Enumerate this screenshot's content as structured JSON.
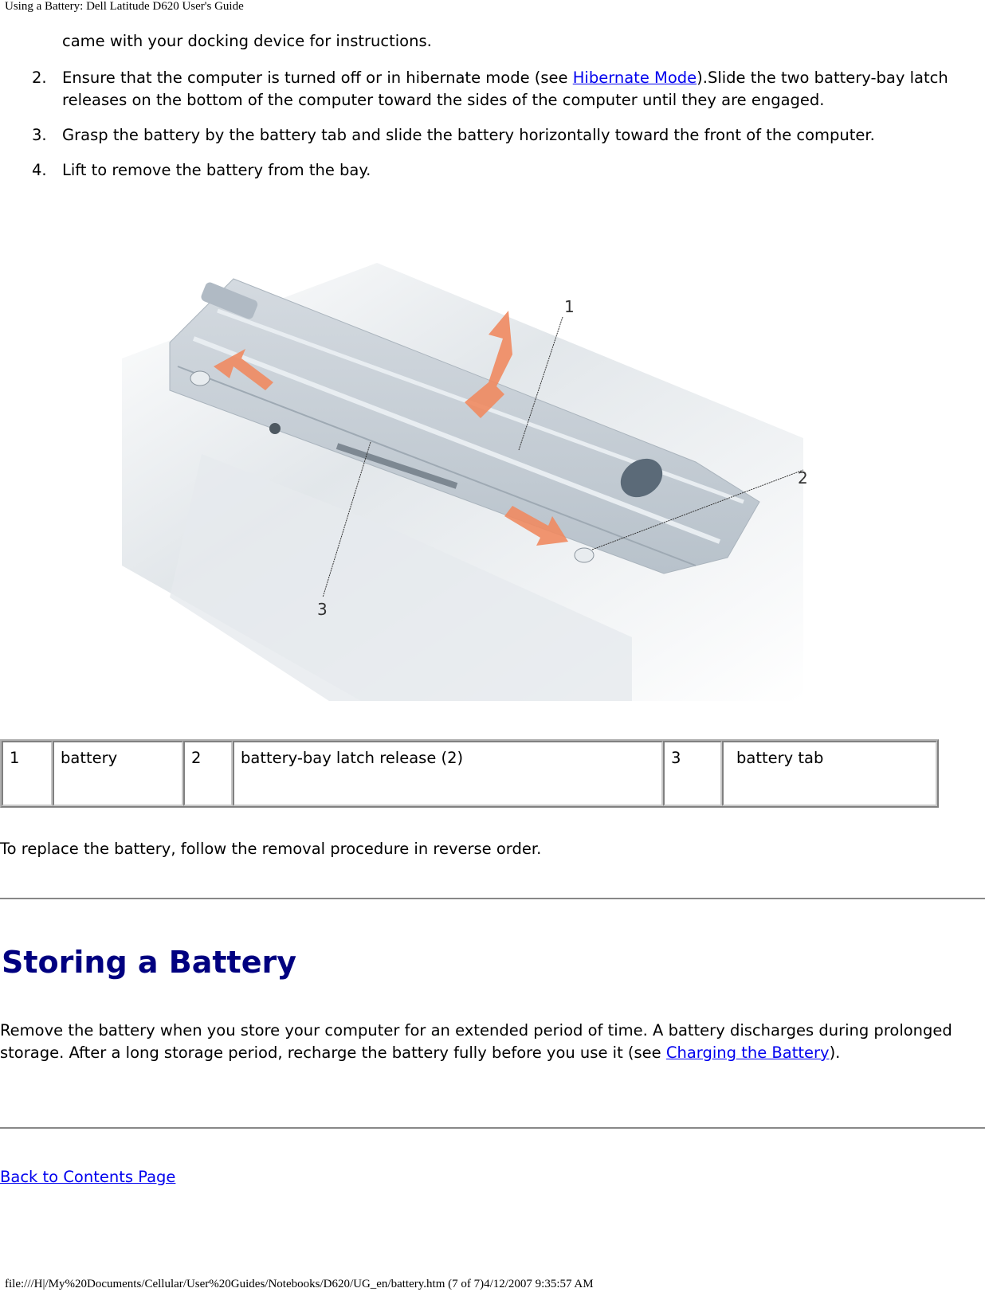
{
  "page_header": "Using a Battery: Dell Latitude D620 User's Guide",
  "continuation_text": "came with your docking device for instructions.",
  "steps": [
    {
      "number": "2.",
      "text_before": "Ensure that the computer is turned off or in hibernate mode (see ",
      "link": "Hibernate Mode",
      "text_after": ").Slide the two battery-bay latch releases on the bottom of the computer toward the sides of the computer until they are engaged."
    },
    {
      "number": "3.",
      "text": "Grasp the battery by the battery tab and slide the battery horizontally toward the front of the computer."
    },
    {
      "number": "4.",
      "text": "Lift to remove the battery from the bay."
    }
  ],
  "figure": {
    "description": "Illustration of removing the battery from the bottom of a Dell Latitude D620 notebook",
    "callouts": [
      "1",
      "2",
      "3"
    ],
    "arrow_color": "#f08a60",
    "battery_color": "#c4ccd4"
  },
  "legend_table": [
    {
      "num": "1",
      "label": "battery"
    },
    {
      "num": "2",
      "label": "battery-bay latch release (2)"
    },
    {
      "num": "3",
      "label": "battery tab"
    }
  ],
  "replace_text": "To replace the battery, follow the removal procedure in reverse order.",
  "section": {
    "title": "Storing a Battery",
    "text_before": "Remove the battery when you store your computer for an extended period of time. A battery discharges during prolonged storage. After a long storage period, recharge the battery fully before you use it (see ",
    "link": "Charging the Battery",
    "text_after": ")."
  },
  "back_link": "Back to Contents Page",
  "footer": "file:///H|/My%20Documents/Cellular/User%20Guides/Notebooks/D620/UG_en/battery.htm (7 of 7)4/12/2007 9:35:57 AM",
  "colors": {
    "link": "#0000ee",
    "heading": "#000080",
    "rule": "#888888"
  }
}
